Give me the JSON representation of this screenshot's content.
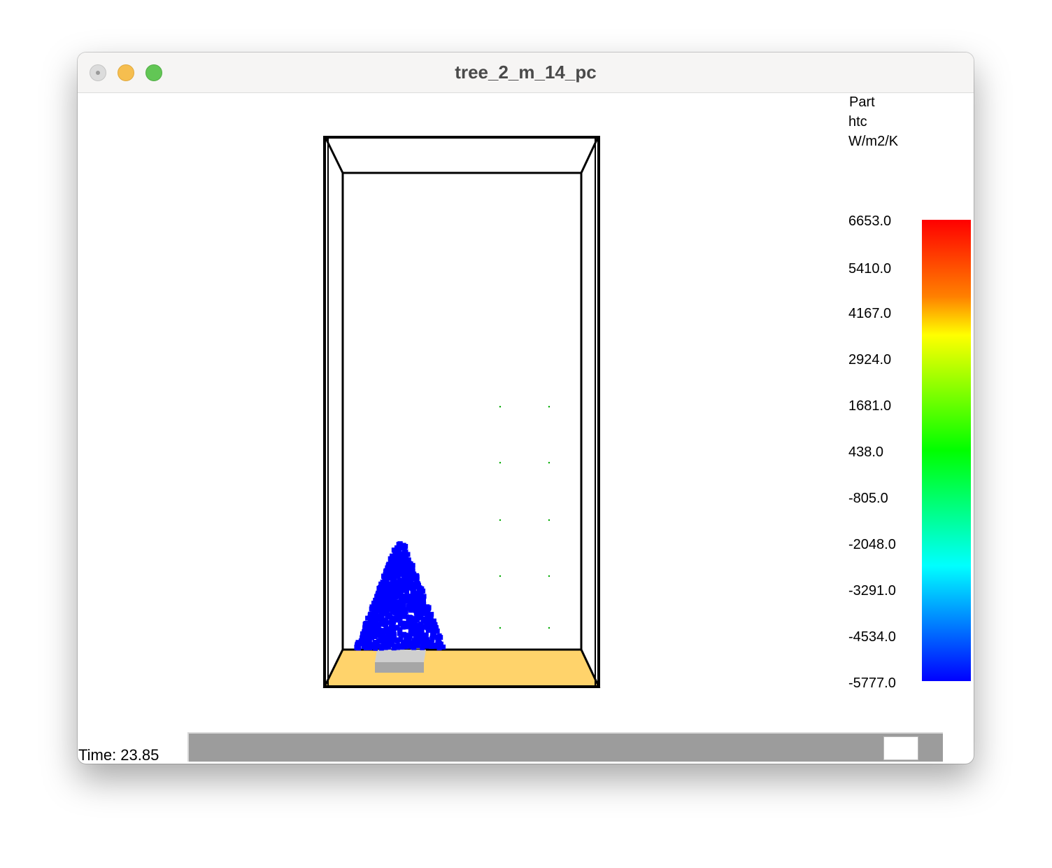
{
  "window": {
    "title": "tree_2_m_14_pc"
  },
  "legend": {
    "title_lines": [
      "Part",
      "htc",
      "W/m2/K"
    ],
    "ticks": [
      "6653.0",
      "5410.0",
      "4167.0",
      "2924.0",
      "1681.0",
      "438.0",
      "-805.0",
      "-2048.0",
      "-3291.0",
      "-4534.0",
      "-5777.0"
    ],
    "max_color": "#ff0000",
    "min_color": "#0000ff"
  },
  "scene": {
    "particle_color": "#0000ff",
    "floor_color": "#ffd36b",
    "sprinkler_color": "#00aa00",
    "block_color": "#a6a6a6"
  },
  "time": {
    "label": "Time: 23.85",
    "progress": 0.97
  }
}
